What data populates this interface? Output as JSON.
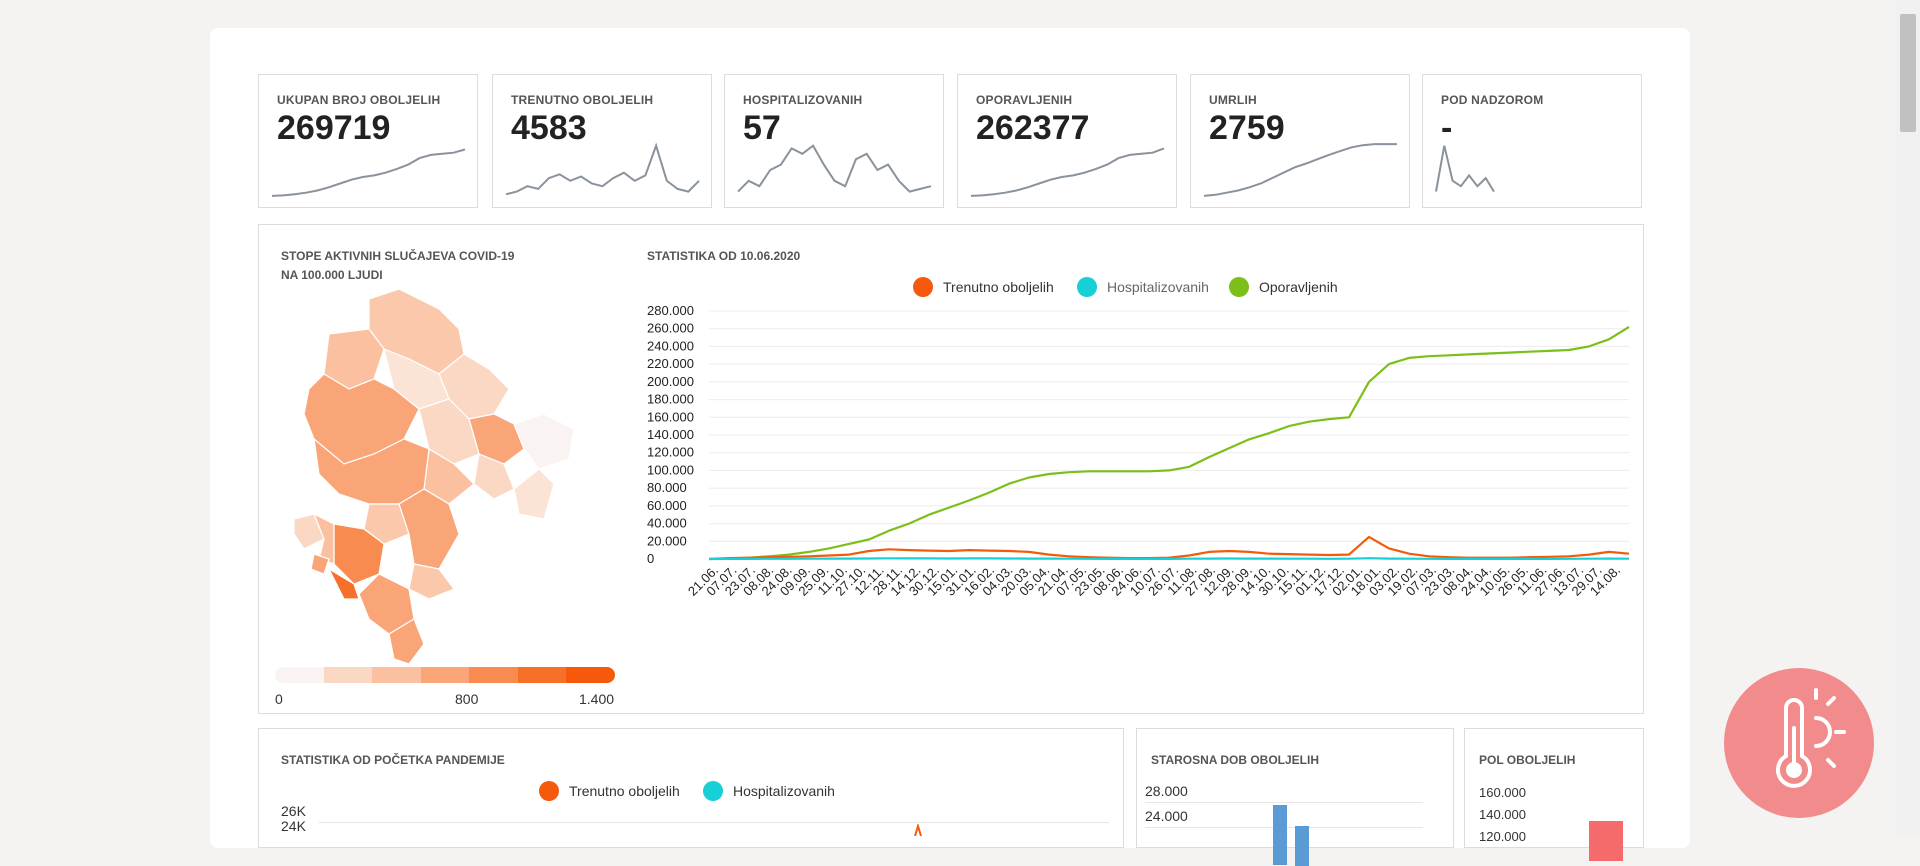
{
  "stats": [
    {
      "label": "UKUPAN BROJ OBOLJELIH",
      "value": "269719",
      "trend": [
        0.02,
        0.03,
        0.05,
        0.08,
        0.12,
        0.18,
        0.25,
        0.32,
        0.37,
        0.4,
        0.45,
        0.52,
        0.6,
        0.72,
        0.78,
        0.8,
        0.82,
        0.88
      ]
    },
    {
      "label": "TRENUTNO OBOLJELIH",
      "value": "4583",
      "trend": [
        0.05,
        0.1,
        0.2,
        0.15,
        0.35,
        0.42,
        0.3,
        0.38,
        0.25,
        0.2,
        0.35,
        0.45,
        0.3,
        0.4,
        0.95,
        0.3,
        0.15,
        0.1,
        0.3
      ]
    },
    {
      "label": "HOSPITALIZOVANIH",
      "value": "57",
      "trend": [
        0.1,
        0.3,
        0.2,
        0.5,
        0.6,
        0.9,
        0.8,
        0.95,
        0.6,
        0.3,
        0.2,
        0.7,
        0.8,
        0.5,
        0.6,
        0.3,
        0.1,
        0.15,
        0.2
      ]
    },
    {
      "label": "OPORAVLJENIH",
      "value": "262377",
      "trend": [
        0.02,
        0.03,
        0.05,
        0.08,
        0.12,
        0.18,
        0.25,
        0.32,
        0.37,
        0.4,
        0.45,
        0.52,
        0.6,
        0.72,
        0.78,
        0.8,
        0.82,
        0.9
      ]
    },
    {
      "label": "UMRLIH",
      "value": "2759",
      "trend": [
        0.02,
        0.04,
        0.08,
        0.12,
        0.18,
        0.25,
        0.35,
        0.45,
        0.55,
        0.62,
        0.7,
        0.78,
        0.85,
        0.92,
        0.96,
        0.98,
        0.98,
        0.98
      ]
    },
    {
      "label": "POD NADZOROM",
      "value": "-",
      "trend": [
        0.1,
        0.95,
        0.3,
        0.2,
        0.4,
        0.2,
        0.35,
        0.1
      ]
    }
  ],
  "map_panel": {
    "title_line1": "STOPE AKTIVNIH SLUČAJEVA COVID-19",
    "title_line2": "NA 100.000 LJUDI",
    "scale_min": "0",
    "scale_mid": "800",
    "scale_max": "1.400",
    "scale_colors": [
      "#f9f3f1",
      "#fbd8c4",
      "#fbc0a0",
      "#f9a578",
      "#f88b4f",
      "#f7702a",
      "#f55a0c"
    ]
  },
  "main_chart": {
    "title": "STATISTIKA OD 10.06.2020",
    "legend": [
      {
        "name": "Trenutno oboljelih",
        "color": "#f55a0c"
      },
      {
        "name": "Hospitalizovanih",
        "color": "#16d0d6"
      },
      {
        "name": "Oporavljenih",
        "color": "#7cbf19"
      }
    ],
    "chart_data": {
      "type": "line",
      "y_ticks": [
        "280.000",
        "260.000",
        "240.000",
        "220.000",
        "200.000",
        "180.000",
        "160.000",
        "140.000",
        "120.000",
        "100.000",
        "80.000",
        "60.000",
        "40.000",
        "20.000",
        "0"
      ],
      "x_ticks": [
        "21.06.",
        "07.07.",
        "23.07.",
        "08.08.",
        "24.08.",
        "09.09.",
        "25.09.",
        "11.10.",
        "27.10.",
        "12.11.",
        "28.11.",
        "14.12.",
        "30.12.",
        "15.01.",
        "31.01.",
        "16.02.",
        "04.03.",
        "20.03.",
        "05.04.",
        "21.04.",
        "07.05.",
        "23.05.",
        "08.06.",
        "24.06.",
        "10.07.",
        "26.07.",
        "11.08.",
        "27.08.",
        "12.09.",
        "28.09.",
        "14.10.",
        "30.10.",
        "15.11.",
        "01.12.",
        "17.12.",
        "02.01.",
        "18.01.",
        "03.02.",
        "19.02.",
        "07.03.",
        "23.03.",
        "08.04.",
        "24.04.",
        "10.05.",
        "26.05.",
        "11.06.",
        "27.06.",
        "13.07.",
        "29.07.",
        "14.08."
      ],
      "ylim": [
        0,
        280000
      ],
      "series": [
        {
          "name": "Oporavljenih",
          "values": [
            0,
            500,
            1500,
            3000,
            5000,
            8000,
            12000,
            17000,
            22000,
            32000,
            40000,
            50000,
            58000,
            66000,
            75000,
            85000,
            92000,
            96000,
            98000,
            99000,
            99000,
            99000,
            99000,
            100000,
            104000,
            115000,
            125000,
            135000,
            142000,
            150000,
            155000,
            158000,
            160000,
            200000,
            220000,
            227000,
            229000,
            230000,
            231000,
            232000,
            233000,
            234000,
            235000,
            236000,
            240000,
            248000,
            262000
          ]
        },
        {
          "name": "Trenutno oboljelih",
          "values": [
            0,
            1000,
            1500,
            2000,
            2500,
            3000,
            4000,
            5000,
            9000,
            11000,
            10000,
            9500,
            9000,
            10000,
            9500,
            9000,
            8000,
            5000,
            3000,
            2000,
            1500,
            1000,
            1000,
            1500,
            4000,
            8000,
            9000,
            8000,
            6000,
            5500,
            5000,
            4500,
            5000,
            25000,
            12000,
            6000,
            3000,
            2000,
            1500,
            1500,
            1500,
            2000,
            2500,
            3000,
            5000,
            8000,
            6000
          ]
        },
        {
          "name": "Hospitalizovanih",
          "values": [
            0,
            100,
            150,
            200,
            250,
            300,
            400,
            500,
            600,
            800,
            700,
            650,
            600,
            700,
            650,
            600,
            500,
            400,
            300,
            200,
            150,
            100,
            100,
            150,
            300,
            500,
            600,
            500,
            400,
            350,
            300,
            250,
            300,
            900,
            500,
            300,
            200,
            150,
            100,
            100,
            100,
            150,
            150,
            200,
            300,
            400,
            300
          ]
        }
      ]
    }
  },
  "bottom_left": {
    "title": "STATISTIKA OD POČETKA PANDEMIJE",
    "legend": [
      {
        "name": "Trenutno oboljelih",
        "color": "#f55a0c"
      },
      {
        "name": "Hospitalizovanih",
        "color": "#16d0d6"
      }
    ],
    "y_ticks": [
      "26K",
      "24K"
    ]
  },
  "bottom_mid": {
    "title": "STAROSNA DOB OBOLJELIH",
    "y_ticks": [
      "28.000",
      "24.000"
    ],
    "bar_color": "#5b9bd5"
  },
  "bottom_right": {
    "title": "POL OBOLJELIH",
    "y_ticks": [
      "160.000",
      "140.000",
      "120.000"
    ],
    "bar_color": "#f56a6a"
  },
  "fab_icon": "thermometer-sun-icon"
}
